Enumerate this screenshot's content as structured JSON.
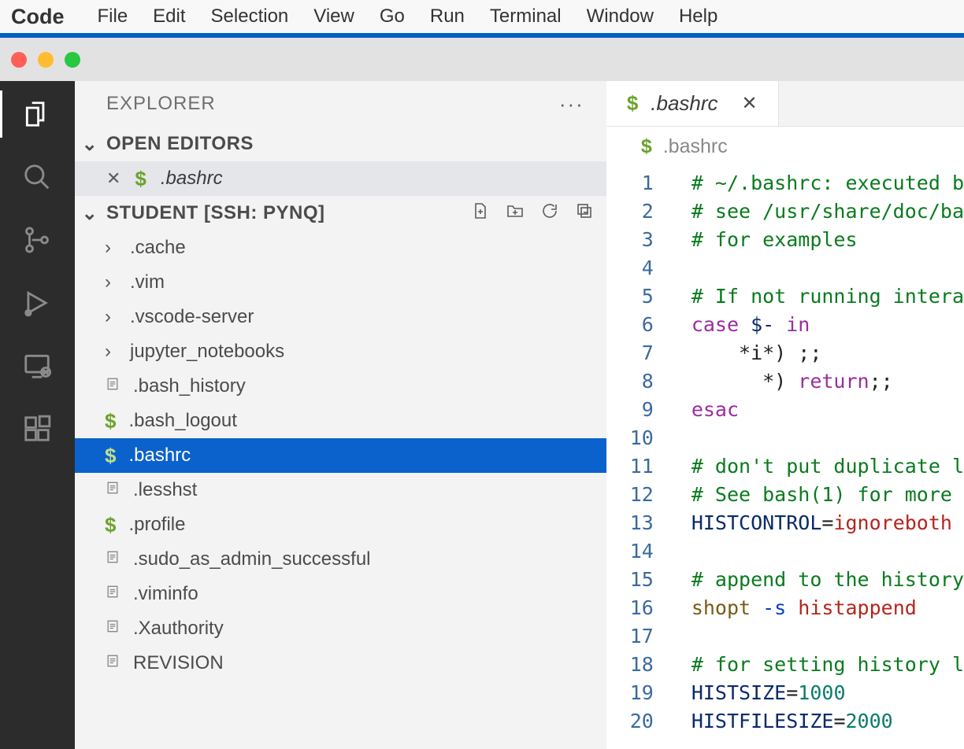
{
  "menu": {
    "app": "Code",
    "items": [
      "File",
      "Edit",
      "Selection",
      "View",
      "Go",
      "Run",
      "Terminal",
      "Window",
      "Help"
    ]
  },
  "traffic_colors": [
    "#ff5f57",
    "#febc2e",
    "#28c840"
  ],
  "sidebar": {
    "title": "EXPLORER",
    "more": "···",
    "open_editors_label": "OPEN EDITORS",
    "open_file": ".bashrc",
    "folder_label": "STUDENT [SSH: PYNQ]",
    "folders": [
      ".cache",
      ".vim",
      ".vscode-server",
      "jupyter_notebooks"
    ],
    "files": [
      {
        "icon": "text",
        "name": ".bash_history"
      },
      {
        "icon": "dollar",
        "name": ".bash_logout"
      },
      {
        "icon": "dollar",
        "name": ".bashrc",
        "selected": true
      },
      {
        "icon": "text",
        "name": ".lesshst"
      },
      {
        "icon": "dollar",
        "name": ".profile"
      },
      {
        "icon": "text",
        "name": ".sudo_as_admin_successful"
      },
      {
        "icon": "text",
        "name": ".viminfo"
      },
      {
        "icon": "text",
        "name": ".Xauthority"
      },
      {
        "icon": "text",
        "name": "REVISION"
      }
    ]
  },
  "editor": {
    "tabname": ".bashrc",
    "breadcrumb": ".bashrc",
    "lines": [
      {
        "n": 1,
        "seg": [
          {
            "cls": "c-green",
            "t": "# ~/.bashrc: executed b"
          }
        ]
      },
      {
        "n": 2,
        "seg": [
          {
            "cls": "c-green",
            "t": "# see /usr/share/doc/ba"
          }
        ]
      },
      {
        "n": 3,
        "seg": [
          {
            "cls": "c-green",
            "t": "# for examples"
          }
        ]
      },
      {
        "n": 4,
        "seg": []
      },
      {
        "n": 5,
        "seg": [
          {
            "cls": "c-green",
            "t": "# If not running intera"
          }
        ]
      },
      {
        "n": 6,
        "seg": [
          {
            "cls": "c-purple",
            "t": "case "
          },
          {
            "cls": "c-navy",
            "t": "$-"
          },
          {
            "cls": "c-purple",
            "t": " in"
          }
        ]
      },
      {
        "n": 7,
        "seg": [
          {
            "cls": "c-default",
            "t": "    *i*) ;;"
          }
        ]
      },
      {
        "n": 8,
        "seg": [
          {
            "cls": "c-default",
            "t": "      *) "
          },
          {
            "cls": "c-purple",
            "t": "return"
          },
          {
            "cls": "c-default",
            "t": ";;"
          }
        ]
      },
      {
        "n": 9,
        "seg": [
          {
            "cls": "c-purple",
            "t": "esac"
          }
        ]
      },
      {
        "n": 10,
        "seg": []
      },
      {
        "n": 11,
        "seg": [
          {
            "cls": "c-green",
            "t": "# don't put duplicate l"
          }
        ]
      },
      {
        "n": 12,
        "seg": [
          {
            "cls": "c-green",
            "t": "# See bash(1) for more "
          }
        ]
      },
      {
        "n": 13,
        "seg": [
          {
            "cls": "c-navy",
            "t": "HISTCONTROL"
          },
          {
            "cls": "c-default",
            "t": "="
          },
          {
            "cls": "c-red",
            "t": "ignoreboth"
          }
        ]
      },
      {
        "n": 14,
        "seg": []
      },
      {
        "n": 15,
        "seg": [
          {
            "cls": "c-green",
            "t": "# append to the history"
          }
        ]
      },
      {
        "n": 16,
        "seg": [
          {
            "cls": "c-darkyellow",
            "t": "shopt "
          },
          {
            "cls": "c-blue",
            "t": "-s "
          },
          {
            "cls": "c-red",
            "t": "histappend"
          }
        ]
      },
      {
        "n": 17,
        "seg": []
      },
      {
        "n": 18,
        "seg": [
          {
            "cls": "c-green",
            "t": "# for setting history l"
          }
        ]
      },
      {
        "n": 19,
        "seg": [
          {
            "cls": "c-navy",
            "t": "HISTSIZE"
          },
          {
            "cls": "c-default",
            "t": "="
          },
          {
            "cls": "c-teal",
            "t": "1000"
          }
        ]
      },
      {
        "n": 20,
        "seg": [
          {
            "cls": "c-navy",
            "t": "HISTFILESIZE"
          },
          {
            "cls": "c-default",
            "t": "="
          },
          {
            "cls": "c-teal",
            "t": "2000"
          }
        ]
      }
    ]
  }
}
